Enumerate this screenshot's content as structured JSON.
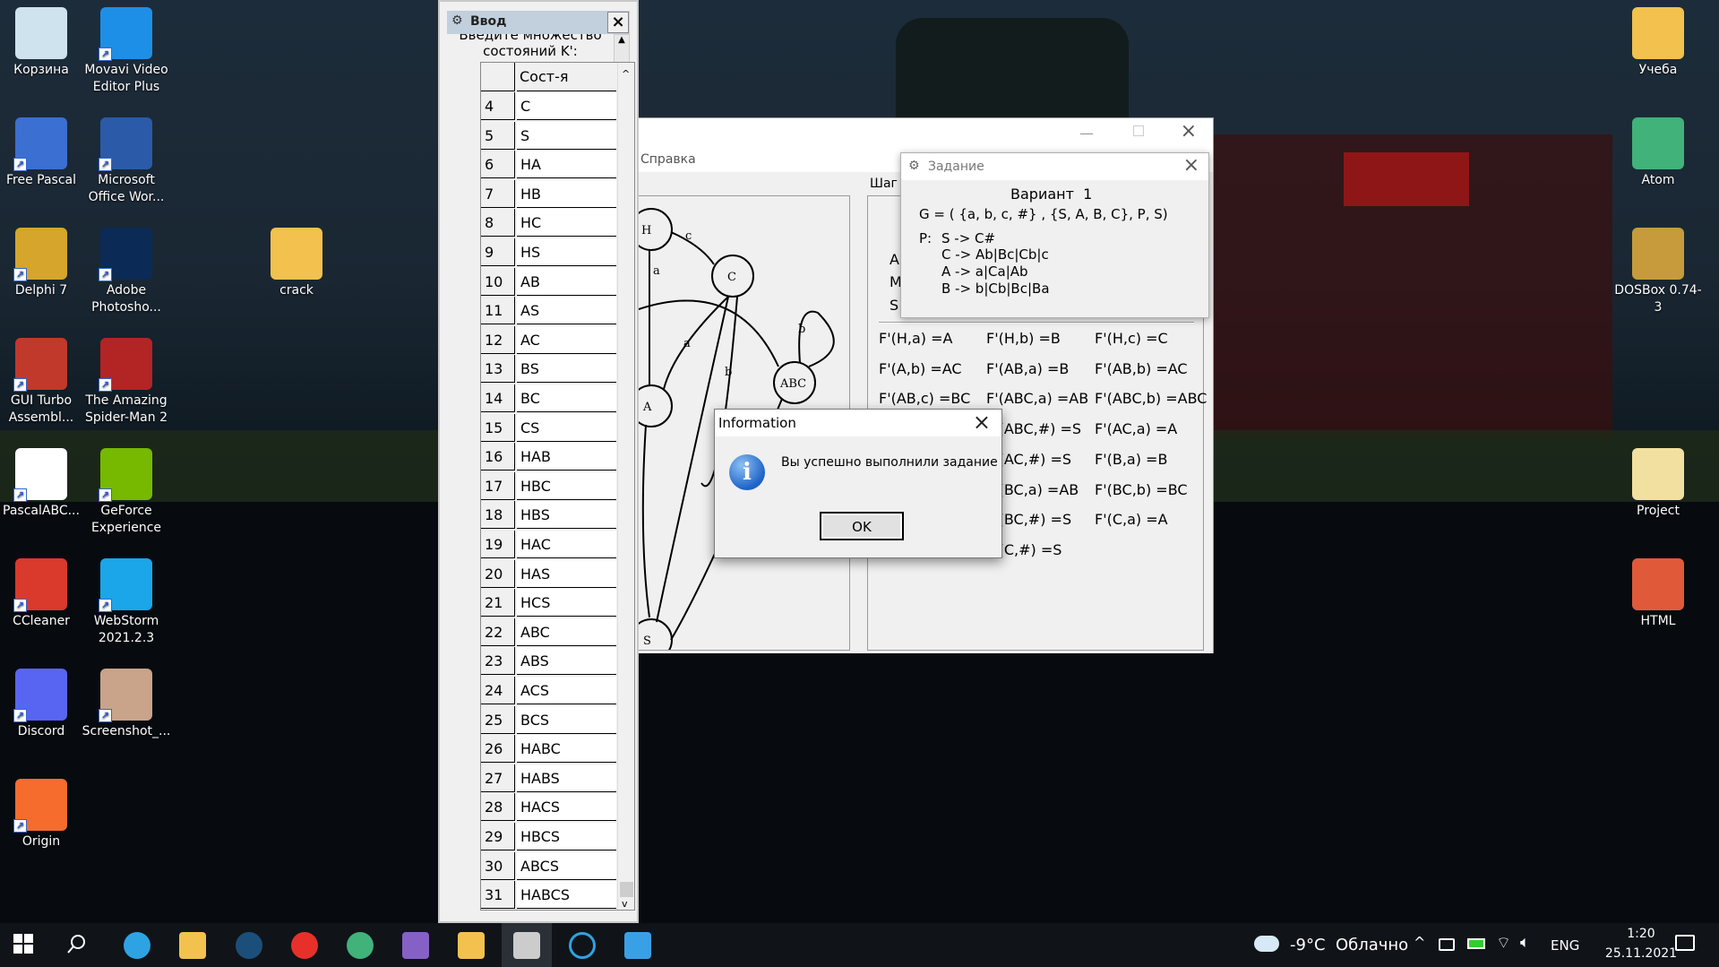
{
  "colors": {
    "desktop_sky": "#1d2c3a",
    "taskbar": "#101418",
    "dialog_bg": "#f0f0f0",
    "info_icon": "#1f63c6"
  },
  "desktop": {
    "left_icons": [
      {
        "label": "Корзина",
        "icon": "recycle-bin-icon",
        "color": "#cfe3ef"
      },
      {
        "label": "Movavi Video Editor Plus",
        "icon": "movavi-icon",
        "color": "#1e8fe6"
      },
      {
        "label": "Free Pascal",
        "icon": "free-pascal-icon",
        "color": "#3b6fd1"
      },
      {
        "label": "Microsoft Office Wor...",
        "icon": "word-icon",
        "color": "#2b5aa8"
      },
      {
        "label": "Delphi 7",
        "icon": "delphi-icon",
        "color": "#d6a52b"
      },
      {
        "label": "Adobe Photosho...",
        "icon": "photoshop-icon",
        "color": "#0b2a55"
      },
      {
        "label": "crack",
        "icon": "folder-icon",
        "color": "#f2c14e"
      },
      {
        "label": "GUI Turbo Assembl...",
        "icon": "tasm-icon",
        "color": "#c0392b"
      },
      {
        "label": "The Amazing Spider-Man 2",
        "icon": "spiderman-icon",
        "color": "#b32424"
      },
      {
        "label": "PascalABC...",
        "icon": "pascalabc-icon",
        "color": "#ffffff"
      },
      {
        "label": "GeForce Experience",
        "icon": "nvidia-icon",
        "color": "#76b900"
      },
      {
        "label": "CCleaner",
        "icon": "ccleaner-icon",
        "color": "#d93a2b"
      },
      {
        "label": "WebStorm 2021.2.3",
        "icon": "webstorm-icon",
        "color": "#1aa6e8"
      },
      {
        "label": "Discord",
        "icon": "discord-icon",
        "color": "#5865f2"
      },
      {
        "label": "Screenshot_...",
        "icon": "image-file-icon",
        "color": "#c9a38a"
      },
      {
        "label": "Origin",
        "icon": "origin-icon",
        "color": "#f56c2d"
      }
    ],
    "right_icons": [
      {
        "label": "Учеба",
        "icon": "folder-doc-icon",
        "color": "#f2c14e"
      },
      {
        "label": "Atom",
        "icon": "atom-icon",
        "color": "#40b27a"
      },
      {
        "label": "DOSBox 0.74-3",
        "icon": "dosbox-icon",
        "color": "#c79b3b"
      },
      {
        "label": "Project",
        "icon": "file-icon",
        "color": "#f2e0a0"
      },
      {
        "label": "HTML",
        "icon": "html-file-icon",
        "color": "#e05a3a"
      }
    ]
  },
  "input_window": {
    "title": "Ввод",
    "prompt_line1": "Введите множество",
    "prompt_line2": "состояний K':",
    "column_header": "Сост-я",
    "rows": [
      {
        "n": "4",
        "v": "C"
      },
      {
        "n": "5",
        "v": "S"
      },
      {
        "n": "6",
        "v": "HA"
      },
      {
        "n": "7",
        "v": "HB"
      },
      {
        "n": "8",
        "v": "HC"
      },
      {
        "n": "9",
        "v": "HS"
      },
      {
        "n": "10",
        "v": "AB"
      },
      {
        "n": "11",
        "v": "AS"
      },
      {
        "n": "12",
        "v": "AC"
      },
      {
        "n": "13",
        "v": "BS"
      },
      {
        "n": "14",
        "v": "BC"
      },
      {
        "n": "15",
        "v": "CS"
      },
      {
        "n": "16",
        "v": "HAB"
      },
      {
        "n": "17",
        "v": "HBC"
      },
      {
        "n": "18",
        "v": "HBS"
      },
      {
        "n": "19",
        "v": "HAC"
      },
      {
        "n": "20",
        "v": "HAS"
      },
      {
        "n": "21",
        "v": "HCS"
      },
      {
        "n": "22",
        "v": "ABC"
      },
      {
        "n": "23",
        "v": "ABS"
      },
      {
        "n": "24",
        "v": "ACS"
      },
      {
        "n": "25",
        "v": "BCS"
      },
      {
        "n": "26",
        "v": "HABC"
      },
      {
        "n": "27",
        "v": "HABS"
      },
      {
        "n": "28",
        "v": "HACS"
      },
      {
        "n": "29",
        "v": "HBCS"
      },
      {
        "n": "30",
        "v": "ABCS"
      },
      {
        "n": "31",
        "v": "HABCS"
      }
    ]
  },
  "main_window": {
    "menu_help": "Справка",
    "step_label": "Шаг 1",
    "left_side_labels": [
      "A",
      "M",
      "S"
    ],
    "graph_nodes": [
      "H",
      "C",
      "A",
      "ABC",
      "S"
    ],
    "graph_edge_labels": [
      "c",
      "a",
      "a",
      "b",
      "b",
      "c"
    ]
  },
  "task_window": {
    "title": "Задание",
    "variant": "Вариант  1",
    "grammar": "G = ( {a, b, c, #} , {S, A, B, C}, P, S)",
    "p_label": "P:",
    "rules": [
      "S -> C#",
      "C -> Ab|Bc|Cb|c",
      "A -> a|Ca|Ab",
      "B -> b|Cb|Bc|Ba"
    ]
  },
  "transitions": [
    [
      "F'(H,a) =A",
      "F'(H,b) =B",
      "F'(H,c) =C"
    ],
    [
      "F'(A,b) =AC",
      "F'(AB,a) =B",
      "F'(AB,b) =AC"
    ],
    [
      "F'(AB,c) =BC",
      "F'(ABC,a) =AB",
      "F'(ABC,b) =ABC"
    ],
    [
      "",
      "F'(ABC,#) =S",
      "F'(AC,a) =A"
    ],
    [
      "",
      "F'(AC,#) =S",
      "F'(B,a) =B"
    ],
    [
      "",
      "F'(BC,a) =AB",
      "F'(BC,b) =BC"
    ],
    [
      "",
      "F'(BC,#) =S",
      "F'(C,a) =A"
    ],
    [
      "",
      "F'(C,#) =S",
      ""
    ]
  ],
  "dialog": {
    "title": "Information",
    "message": "Вы успешно выполнили задание",
    "ok": "OK",
    "icon": "info-icon"
  },
  "taskbar": {
    "apps": [
      {
        "name": "windows-start",
        "icon": "windows-icon",
        "color": "#ffffff"
      },
      {
        "name": "search",
        "icon": "search-icon",
        "color": "#ffffff"
      },
      {
        "name": "edge",
        "icon": "edge-icon",
        "color": "#2ea3e3"
      },
      {
        "name": "explorer",
        "icon": "folder-icon",
        "color": "#f2c14e"
      },
      {
        "name": "steam",
        "icon": "steam-icon",
        "color": "#1b4f7a"
      },
      {
        "name": "yandex",
        "icon": "yandex-icon",
        "color": "#e8302b"
      },
      {
        "name": "atom",
        "icon": "atom-icon",
        "color": "#40b27a"
      },
      {
        "name": "visual-studio",
        "icon": "visual-studio-icon",
        "color": "#8661c5"
      },
      {
        "name": "file-manager",
        "icon": "file-manager-icon",
        "color": "#f2c14e"
      },
      {
        "name": "delphi-app",
        "icon": "gear-icon",
        "color": "#cccccc"
      },
      {
        "name": "loading-app",
        "icon": "circle-icon",
        "color": "#2ea3e3"
      },
      {
        "name": "photos",
        "icon": "photos-icon",
        "color": "#3aa0e6"
      }
    ],
    "weather": "-9°C  Облачно",
    "lang": "ENG",
    "time": "1:20",
    "date": "25.11.2021"
  }
}
